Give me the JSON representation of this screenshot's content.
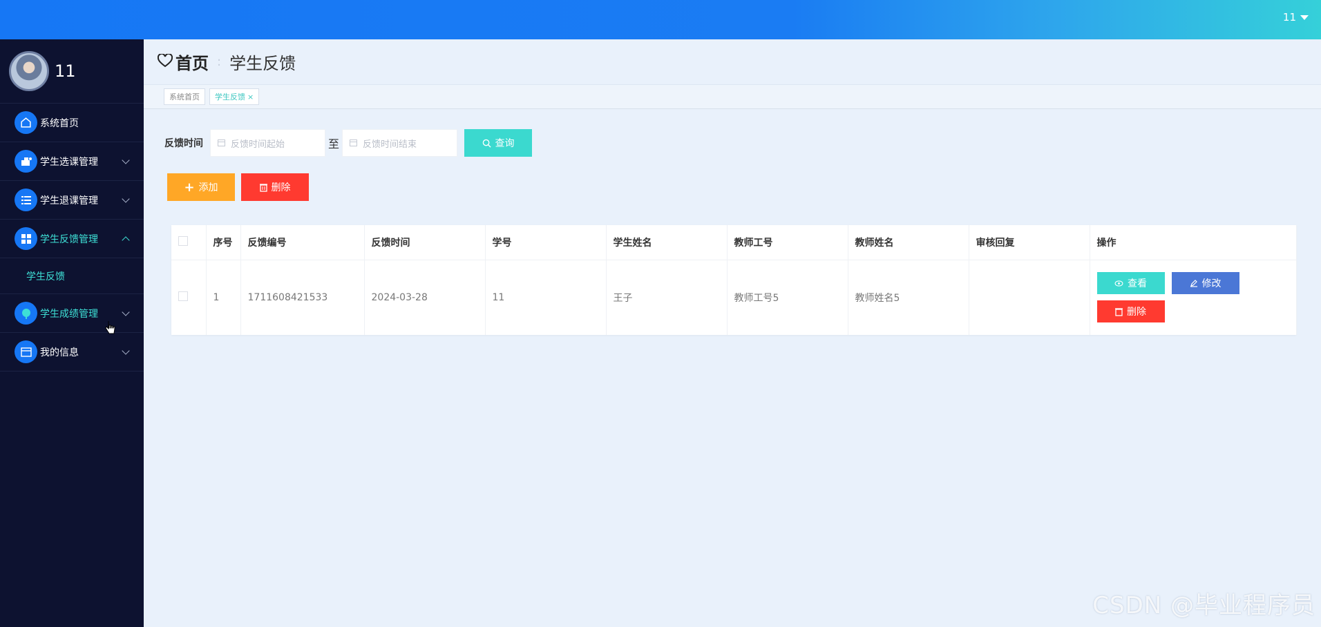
{
  "topbar": {
    "username": "11"
  },
  "sidebar": {
    "profile_name": "11",
    "items": [
      {
        "label": "系统首页",
        "icon": "home-icon"
      },
      {
        "label": "学生选课管理",
        "icon": "course-icon"
      },
      {
        "label": "学生退课管理",
        "icon": "list-icon"
      },
      {
        "label": "学生反馈管理",
        "icon": "grid-icon"
      },
      {
        "label": "学生成绩管理",
        "icon": "score-icon"
      },
      {
        "label": "我的信息",
        "icon": "card-icon"
      }
    ],
    "submenu": {
      "label": "学生反馈"
    }
  },
  "header": {
    "home": "首页",
    "current": "学生反馈"
  },
  "tabs": [
    {
      "label": "系统首页"
    },
    {
      "label": "学生反馈",
      "close": "×"
    }
  ],
  "search": {
    "label": "反馈时间",
    "start_placeholder": "反馈时间起始",
    "to": "至",
    "end_placeholder": "反馈时间结束",
    "query_label": "查询"
  },
  "actions": {
    "add_label": "添加",
    "delete_label": "删除"
  },
  "table": {
    "headers": [
      "",
      "序号",
      "反馈编号",
      "反馈时间",
      "学号",
      "学生姓名",
      "教师工号",
      "教师姓名",
      "审核回复",
      "操作"
    ],
    "rows": [
      {
        "index": "1",
        "feedback_no": "1711608421533",
        "time": "2024-03-28",
        "student_no": "11",
        "student_name": "王子",
        "teacher_no": "教师工号5",
        "teacher_name": "教师姓名5",
        "reply": "",
        "view_label": "查看",
        "edit_label": "修改",
        "delete_label": "删除"
      }
    ]
  },
  "watermark": "CSDN @毕业程序员",
  "colors": {
    "topbar": "#1677f5",
    "sidebar": "#0d1230",
    "accent": "#3bd9cf",
    "warning": "#ffa726",
    "danger": "#ff3a30",
    "primary": "#4b77d6"
  }
}
